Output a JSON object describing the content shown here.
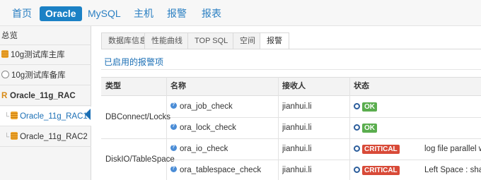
{
  "nav": {
    "items": [
      {
        "label": "首页"
      },
      {
        "label": "Oracle"
      },
      {
        "label": "MySQL"
      },
      {
        "label": "主机"
      },
      {
        "label": "报警"
      },
      {
        "label": "报表"
      }
    ],
    "active_index": 1
  },
  "sidebar": {
    "overview": "总览",
    "items": [
      {
        "label": "10g测试库主库",
        "icon": "database-icon"
      },
      {
        "label": "10g测试库备库",
        "icon": "standby-database-icon"
      },
      {
        "label": "Oracle_11g_RAC",
        "icon": "rac-icon"
      },
      {
        "label": "Oracle_11g_RAC1",
        "icon": "database-icon",
        "active": true
      },
      {
        "label": "Oracle_11g_RAC2",
        "icon": "database-icon"
      }
    ]
  },
  "tabs": [
    {
      "label": "数据库信息"
    },
    {
      "label": "性能曲线"
    },
    {
      "label": "TOP SQL"
    },
    {
      "label": "空间"
    },
    {
      "label": "报警",
      "active": true
    }
  ],
  "section_title": "已启用的报警项",
  "table": {
    "headers": {
      "type": "类型",
      "name": "名称",
      "receiver": "接收人",
      "status": "状态"
    },
    "groups": [
      {
        "type": "DBConnect/Locks",
        "rows": [
          {
            "name": "ora_job_check",
            "receiver": "jianhui.li",
            "status": "OK",
            "message": ""
          },
          {
            "name": "ora_lock_check",
            "receiver": "jianhui.li",
            "status": "OK",
            "message": ""
          }
        ]
      },
      {
        "type": "DiskIO/TableSpace",
        "rows": [
          {
            "name": "ora_io_check",
            "receiver": "jianhui.li",
            "status": "CRITICAL",
            "message": "log file parallel writ"
          },
          {
            "name": "ora_tablespace_check",
            "receiver": "jianhui.li",
            "status": "CRITICAL",
            "message": "Left Space : shalv_"
          }
        ]
      }
    ]
  },
  "colors": {
    "accent": "#1b81c5",
    "ok": "#5aad4e",
    "critical": "#d84a38"
  }
}
